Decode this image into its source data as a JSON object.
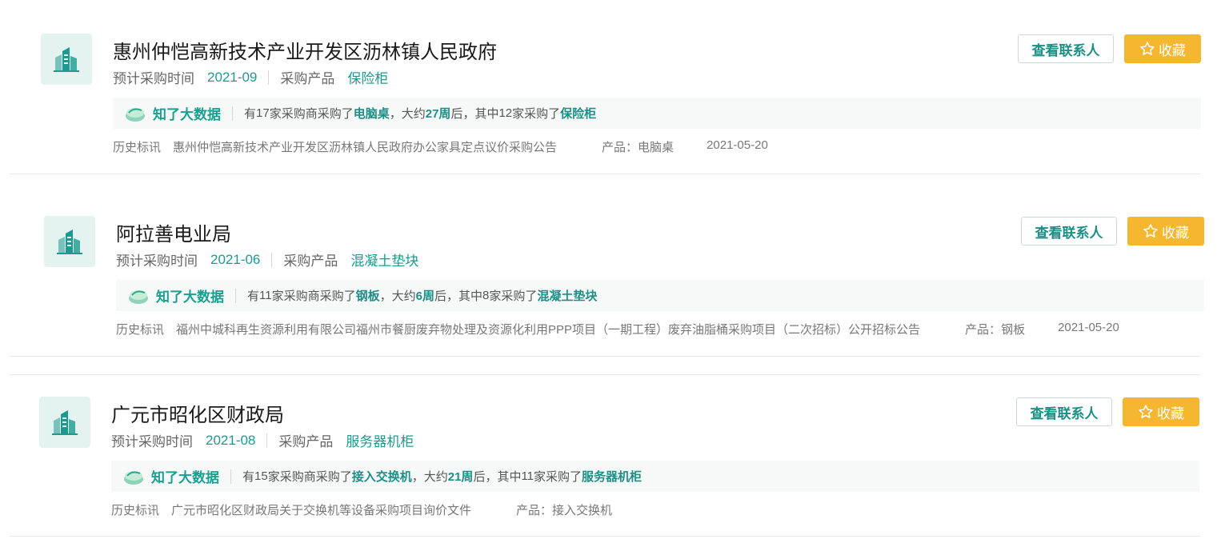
{
  "labels": {
    "purchase_time": "预计采购时间",
    "purchase_product": "采购产品",
    "view_contact": "查看联系人",
    "favorite": "收藏",
    "bigdata_title": "知了大数据",
    "history": "历史标讯",
    "product_prefix": "产品："
  },
  "colors": {
    "accent": "#1d9a8f",
    "favorite": "#f5b72f",
    "logo_bg": "#e4f3ef"
  },
  "cards": [
    {
      "company": "惠州仲恺高新技术产业开发区沥林镇人民政府",
      "purchase_time": "2021-09",
      "product": "保险柜",
      "bigdata": {
        "t1": "有",
        "n1": "17",
        "t2": "家采购商采购了",
        "p1": "电脑桌",
        "t3": "，大约",
        "n2": "27周",
        "t4": "后，其中",
        "n3": "12",
        "t5": "家采购了",
        "p2": "保险柜"
      },
      "history_title": "惠州仲恺高新技术产业开发区沥林镇人民政府办公家具定点议价采购公告",
      "history_product": "电脑桌",
      "history_date": "2021-05-20"
    },
    {
      "company": "阿拉善电业局",
      "purchase_time": "2021-06",
      "product": "混凝土垫块",
      "bigdata": {
        "t1": "有",
        "n1": "11",
        "t2": "家采购商采购了",
        "p1": "钢板",
        "t3": "，大约",
        "n2": "6周",
        "t4": "后，其中",
        "n3": "8",
        "t5": "家采购了",
        "p2": "混凝土垫块"
      },
      "history_title": "福州中城科再生资源利用有限公司福州市餐厨废弃物处理及资源化利用PPP项目（一期工程）废弃油脂桶采购项目（二次招标）公开招标公告",
      "history_product": "钢板",
      "history_date": "2021-05-20"
    },
    {
      "company": "广元市昭化区财政局",
      "purchase_time": "2021-08",
      "product": "服务器机柜",
      "bigdata": {
        "t1": "有",
        "n1": "15",
        "t2": "家采购商采购了",
        "p1": "接入交换机",
        "t3": "，大约",
        "n2": "21周",
        "t4": "后，其中",
        "n3": "11",
        "t5": "家采购了",
        "p2": "服务器机柜"
      },
      "history_title": "广元市昭化区财政局关于交换机等设备采购项目询价文件",
      "history_product": "接入交换机",
      "history_date": ""
    }
  ]
}
